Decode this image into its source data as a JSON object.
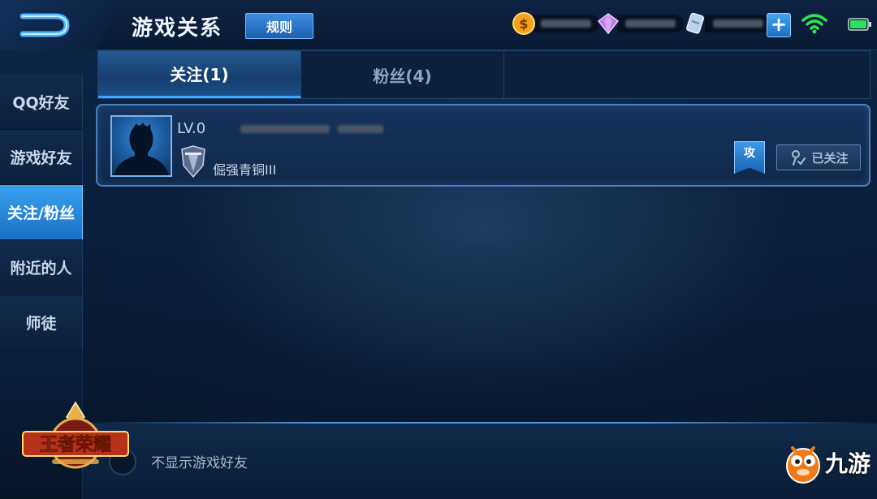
{
  "header": {
    "title": "游戏关系",
    "rule_button": "规则"
  },
  "sidebar": {
    "items": [
      {
        "label": "QQ好友",
        "active": false
      },
      {
        "label": "游戏好友",
        "active": false
      },
      {
        "label": "关注/粉丝",
        "active": true
      },
      {
        "label": "附近的人",
        "active": false
      },
      {
        "label": "师徒",
        "active": false
      }
    ]
  },
  "tabs": [
    {
      "label": "关注(1)",
      "active": true
    },
    {
      "label": "粉丝(4)",
      "active": false
    }
  ],
  "friend": {
    "level": "LV.0",
    "rank": "倔强青铜III",
    "badge": "攻",
    "follow_button": "已关注"
  },
  "footer": {
    "toggle_label": "不显示游戏好友",
    "logo_text": "王者荣耀",
    "watermark": "九游"
  },
  "colors": {
    "accent": "#3aa9ff",
    "active_tab": "#245a94",
    "background": "#0b1b33"
  },
  "icons": [
    "back-icon",
    "gold-coin-icon",
    "diamond-icon",
    "coupon-icon",
    "plus-icon",
    "wifi-icon",
    "battery-icon",
    "rank-shield-icon",
    "followed-icon"
  ]
}
